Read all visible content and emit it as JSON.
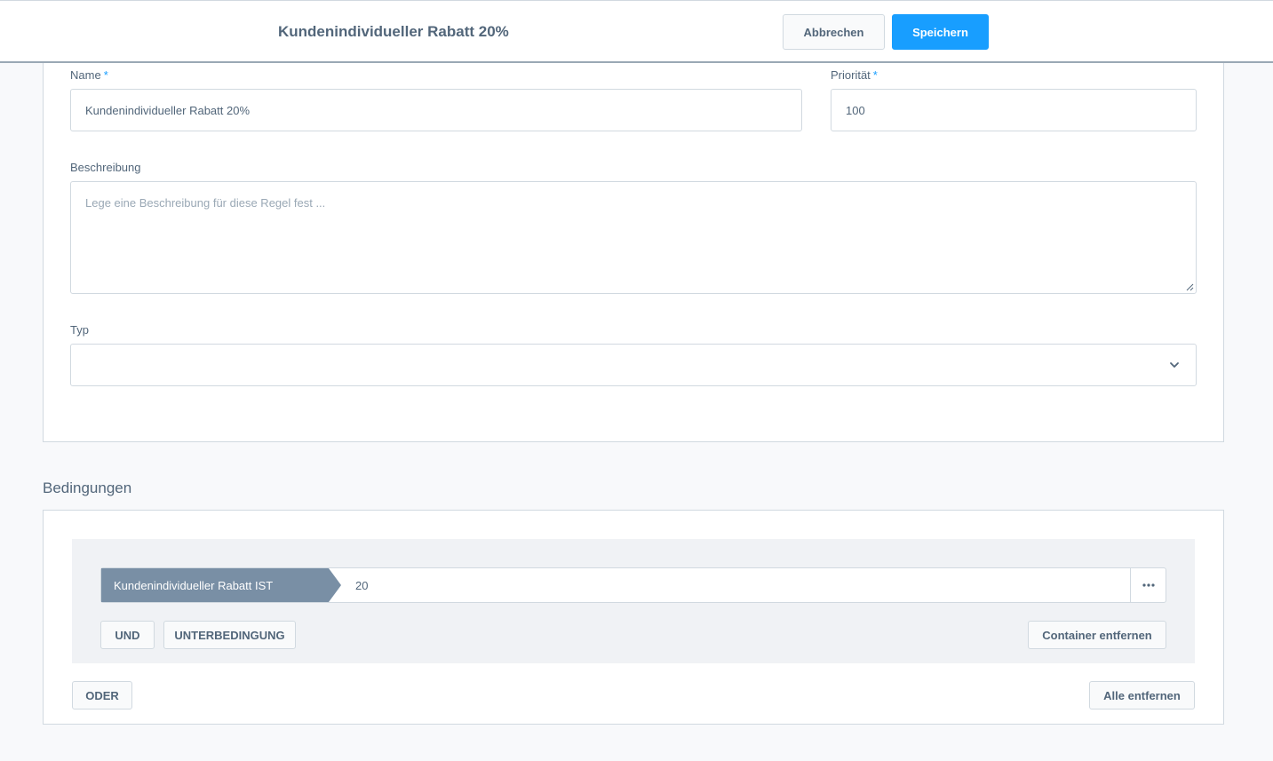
{
  "header": {
    "title": "Kundenindividueller Rabatt 20%",
    "cancel_label": "Abbrechen",
    "save_label": "Speichern"
  },
  "form": {
    "name_label": "Name",
    "name_value": "Kundenindividueller Rabatt 20%",
    "priority_label": "Priorität",
    "priority_value": "100",
    "required_marker": "*",
    "description_label": "Beschreibung",
    "description_placeholder": "Lege eine Beschreibung für diese Regel fest ...",
    "type_label": "Typ",
    "type_value": ""
  },
  "conditions": {
    "section_title": "Bedingungen",
    "items": [
      {
        "type_label": "Kundenindividueller Rabatt IST",
        "value": "20"
      }
    ],
    "and_label": "UND",
    "subcondition_label": "UNTERBEDINGUNG",
    "remove_container_label": "Container entfernen",
    "or_label": "ODER",
    "remove_all_label": "Alle entfernen"
  },
  "colors": {
    "primary": "#189eff",
    "condition_type_bg": "#798fa5",
    "text": "#52667a",
    "border": "#d1d9e0"
  }
}
